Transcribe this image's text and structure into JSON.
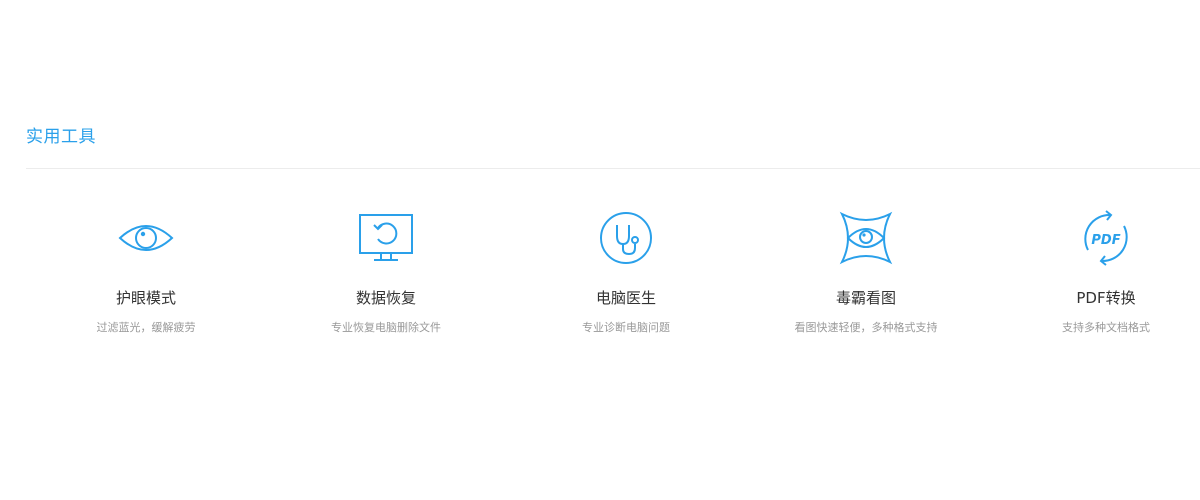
{
  "section": {
    "title": "实用工具"
  },
  "tools": [
    {
      "name": "护眼模式",
      "description": "过滤蓝光，缓解疲劳",
      "icon": "eye-icon"
    },
    {
      "name": "数据恢复",
      "description": "专业恢复电脑删除文件",
      "icon": "monitor-restore-icon"
    },
    {
      "name": "电脑医生",
      "description": "专业诊断电脑问题",
      "icon": "stethoscope-icon"
    },
    {
      "name": "毒霸看图",
      "description": "看图快速轻便，多种格式支持",
      "icon": "image-viewer-eye-icon"
    },
    {
      "name": "PDF转换",
      "description": "支持多种文档格式",
      "icon": "pdf-convert-icon",
      "icon_text": "PDF"
    }
  ],
  "colors": {
    "accent": "#2aa0ea",
    "icon_stroke": "#2aa0ea",
    "title_text": "#333333",
    "desc_text": "#999999",
    "divider": "#ececec"
  }
}
